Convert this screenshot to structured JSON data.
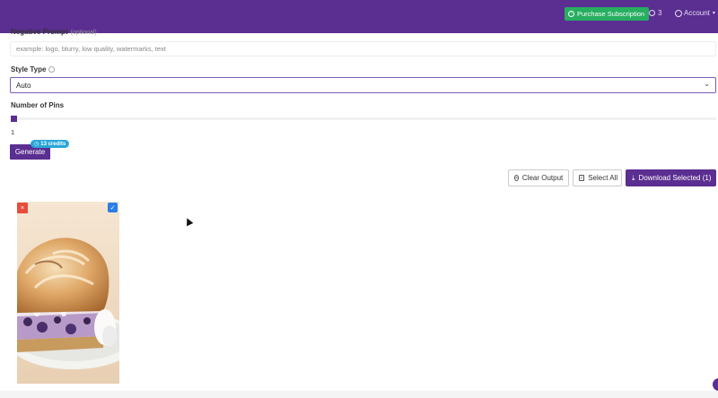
{
  "header": {
    "purchase_label": "Purchase Subscription",
    "credits_count": "3",
    "account_label": "Account"
  },
  "form": {
    "negative_prompt": {
      "label": "Negative Prompt",
      "optional_label": "(optional)",
      "placeholder": "example: logo, blurry, low quality, watermarks, text",
      "value": ""
    },
    "style_type": {
      "label": "Style Type",
      "selected": "Auto"
    },
    "number_of_pins": {
      "label": "Number of Pins",
      "value": "1"
    },
    "generate": {
      "label": "Generate",
      "credits_badge": "13 credits"
    }
  },
  "output_toolbar": {
    "clear_label": "Clear Output",
    "select_all_label": "Select All",
    "download_label": "Download Selected (1)"
  },
  "results": [
    {
      "remove_label": "×",
      "selected": true,
      "check_label": "✓",
      "image": "meringue-topped-blueberry-cheesecake-slice"
    }
  ],
  "colors": {
    "brand": "#5b2e91",
    "purchase": "#27ae60",
    "badge": "#29a6d8",
    "remove": "#e74c3c",
    "check": "#2b7de9"
  }
}
